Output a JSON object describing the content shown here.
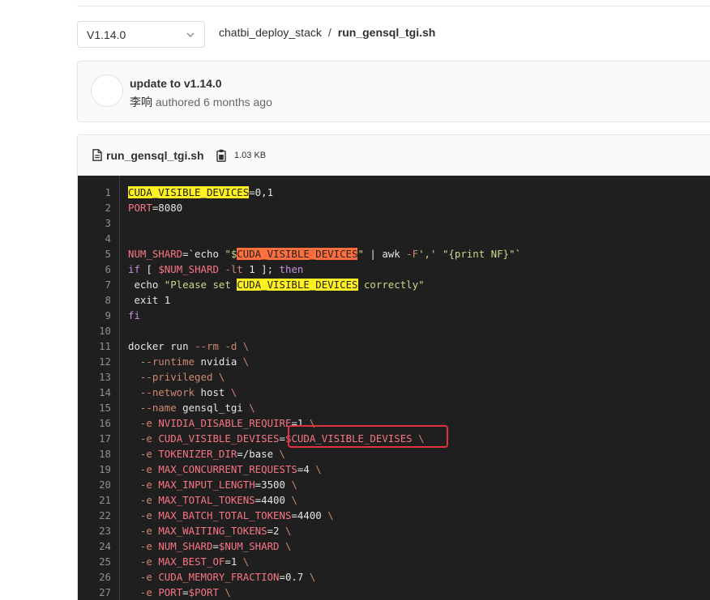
{
  "branch_selector": {
    "value": "V1.14.0",
    "chevron_icon": "chevron-down-icon"
  },
  "breadcrumb": {
    "project": "chatbi_deploy_stack",
    "separator": "/",
    "file": "run_gensql_tgi.sh"
  },
  "commit": {
    "title": "update to v1.14.0",
    "author": "李响",
    "authored_text": "authored 6 months ago"
  },
  "file_header": {
    "file_icon": "file-icon",
    "name": "run_gensql_tgi.sh",
    "copy_icon": "copy-icon",
    "size": "1.03 KB"
  },
  "code": {
    "line_numbers": [
      "1",
      "2",
      "3",
      "4",
      "5",
      "6",
      "7",
      "8",
      "9",
      "10",
      "11",
      "12",
      "13",
      "14",
      "15",
      "16",
      "17",
      "18",
      "19",
      "20",
      "21",
      "22",
      "23",
      "24",
      "25",
      "26",
      "27"
    ],
    "lines": [
      [
        [
          "hl-y",
          "CUDA_VISIBLE_DEVICES"
        ],
        [
          "p",
          "=0,1"
        ]
      ],
      [
        [
          "var",
          "PORT"
        ],
        [
          "p",
          "=8080"
        ]
      ],
      [],
      [],
      [
        [
          "var",
          "NUM_SHARD"
        ],
        [
          "p",
          "=`echo "
        ],
        [
          "str",
          "\"$"
        ],
        [
          "hl-o",
          "CUDA_VISIBLE_DEVICES"
        ],
        [
          "str",
          "\""
        ],
        [
          "p",
          " | awk "
        ],
        [
          "op",
          "-F"
        ],
        [
          "str",
          "','"
        ],
        [
          "p",
          " "
        ],
        [
          "str",
          "\"{print NF}\""
        ],
        [
          "p",
          "`"
        ]
      ],
      [
        [
          "kw",
          "if"
        ],
        [
          "p",
          " [ "
        ],
        [
          "var",
          "$NUM_SHARD"
        ],
        [
          "p",
          " "
        ],
        [
          "op",
          "-lt"
        ],
        [
          "p",
          " 1 ]; "
        ],
        [
          "kw",
          "then"
        ]
      ],
      [
        [
          "p",
          " echo "
        ],
        [
          "str",
          "\"Please set "
        ],
        [
          "hl-y",
          "CUDA_VISIBLE_DEVICES"
        ],
        [
          "str",
          " correctly\""
        ]
      ],
      [
        [
          "p",
          " exit 1"
        ]
      ],
      [
        [
          "kw",
          "fi"
        ]
      ],
      [],
      [
        [
          "p",
          "docker run "
        ],
        [
          "op",
          "--rm"
        ],
        [
          "p",
          " "
        ],
        [
          "op",
          "-d"
        ],
        [
          "p",
          " "
        ],
        [
          "op",
          "\\"
        ]
      ],
      [
        [
          "p",
          "  "
        ],
        [
          "op",
          "--runtime"
        ],
        [
          "p",
          " nvidia "
        ],
        [
          "op",
          "\\"
        ]
      ],
      [
        [
          "p",
          "  "
        ],
        [
          "op",
          "--privileged"
        ],
        [
          "p",
          " "
        ],
        [
          "op",
          "\\"
        ]
      ],
      [
        [
          "p",
          "  "
        ],
        [
          "op",
          "--network"
        ],
        [
          "p",
          " host "
        ],
        [
          "op",
          "\\"
        ]
      ],
      [
        [
          "p",
          "  "
        ],
        [
          "op",
          "--name"
        ],
        [
          "p",
          " gensql_tgi "
        ],
        [
          "op",
          "\\"
        ]
      ],
      [
        [
          "p",
          "  "
        ],
        [
          "op",
          "-e"
        ],
        [
          "p",
          " "
        ],
        [
          "var",
          "NVIDIA_DISABLE_REQUIRE"
        ],
        [
          "p",
          "=1 "
        ],
        [
          "op",
          "\\"
        ]
      ],
      [
        [
          "p",
          "  "
        ],
        [
          "op",
          "-e"
        ],
        [
          "p",
          " "
        ],
        [
          "var",
          "CUDA_VISIBLE_DEVISES"
        ],
        [
          "p",
          "="
        ],
        [
          "var",
          "$CUDA_VISIBLE_DEVISES"
        ],
        [
          "p",
          " "
        ],
        [
          "op",
          "\\"
        ]
      ],
      [
        [
          "p",
          "  "
        ],
        [
          "op",
          "-e"
        ],
        [
          "p",
          " "
        ],
        [
          "var",
          "TOKENIZER_DIR"
        ],
        [
          "p",
          "=/base "
        ],
        [
          "op",
          "\\"
        ]
      ],
      [
        [
          "p",
          "  "
        ],
        [
          "op",
          "-e"
        ],
        [
          "p",
          " "
        ],
        [
          "var",
          "MAX_CONCURRENT_REQUESTS"
        ],
        [
          "p",
          "=4 "
        ],
        [
          "op",
          "\\"
        ]
      ],
      [
        [
          "p",
          "  "
        ],
        [
          "op",
          "-e"
        ],
        [
          "p",
          " "
        ],
        [
          "var",
          "MAX_INPUT_LENGTH"
        ],
        [
          "p",
          "=3500 "
        ],
        [
          "op",
          "\\"
        ]
      ],
      [
        [
          "p",
          "  "
        ],
        [
          "op",
          "-e"
        ],
        [
          "p",
          " "
        ],
        [
          "var",
          "MAX_TOTAL_TOKENS"
        ],
        [
          "p",
          "=4400 "
        ],
        [
          "op",
          "\\"
        ]
      ],
      [
        [
          "p",
          "  "
        ],
        [
          "op",
          "-e"
        ],
        [
          "p",
          " "
        ],
        [
          "var",
          "MAX_BATCH_TOTAL_TOKENS"
        ],
        [
          "p",
          "=4400 "
        ],
        [
          "op",
          "\\"
        ]
      ],
      [
        [
          "p",
          "  "
        ],
        [
          "op",
          "-e"
        ],
        [
          "p",
          " "
        ],
        [
          "var",
          "MAX_WAITING_TOKENS"
        ],
        [
          "p",
          "=2 "
        ],
        [
          "op",
          "\\"
        ]
      ],
      [
        [
          "p",
          "  "
        ],
        [
          "op",
          "-e"
        ],
        [
          "p",
          " "
        ],
        [
          "var",
          "NUM_SHARD"
        ],
        [
          "p",
          "="
        ],
        [
          "var",
          "$NUM_SHARD"
        ],
        [
          "p",
          " "
        ],
        [
          "op",
          "\\"
        ]
      ],
      [
        [
          "p",
          "  "
        ],
        [
          "op",
          "-e"
        ],
        [
          "p",
          " "
        ],
        [
          "var",
          "MAX_BEST_OF"
        ],
        [
          "p",
          "=1 "
        ],
        [
          "op",
          "\\"
        ]
      ],
      [
        [
          "p",
          "  "
        ],
        [
          "op",
          "-e"
        ],
        [
          "p",
          " "
        ],
        [
          "var",
          "CUDA_MEMORY_FRACTION"
        ],
        [
          "p",
          "=0.7 "
        ],
        [
          "op",
          "\\"
        ]
      ],
      [
        [
          "p",
          "  "
        ],
        [
          "op",
          "-e"
        ],
        [
          "p",
          " "
        ],
        [
          "var",
          "PORT"
        ],
        [
          "p",
          "="
        ],
        [
          "var",
          "$PORT"
        ],
        [
          "p",
          " "
        ],
        [
          "op",
          "\\"
        ]
      ]
    ]
  },
  "colors": {
    "code_background": "#1f1f1f",
    "variable": "#f97583",
    "string": "#cfd58a",
    "keyword": "#c98ede",
    "operator": "#d08770",
    "highlight_yellow": "#fff01f",
    "highlight_orange": "#ff6f3c",
    "annotation_red": "#e0323c"
  }
}
